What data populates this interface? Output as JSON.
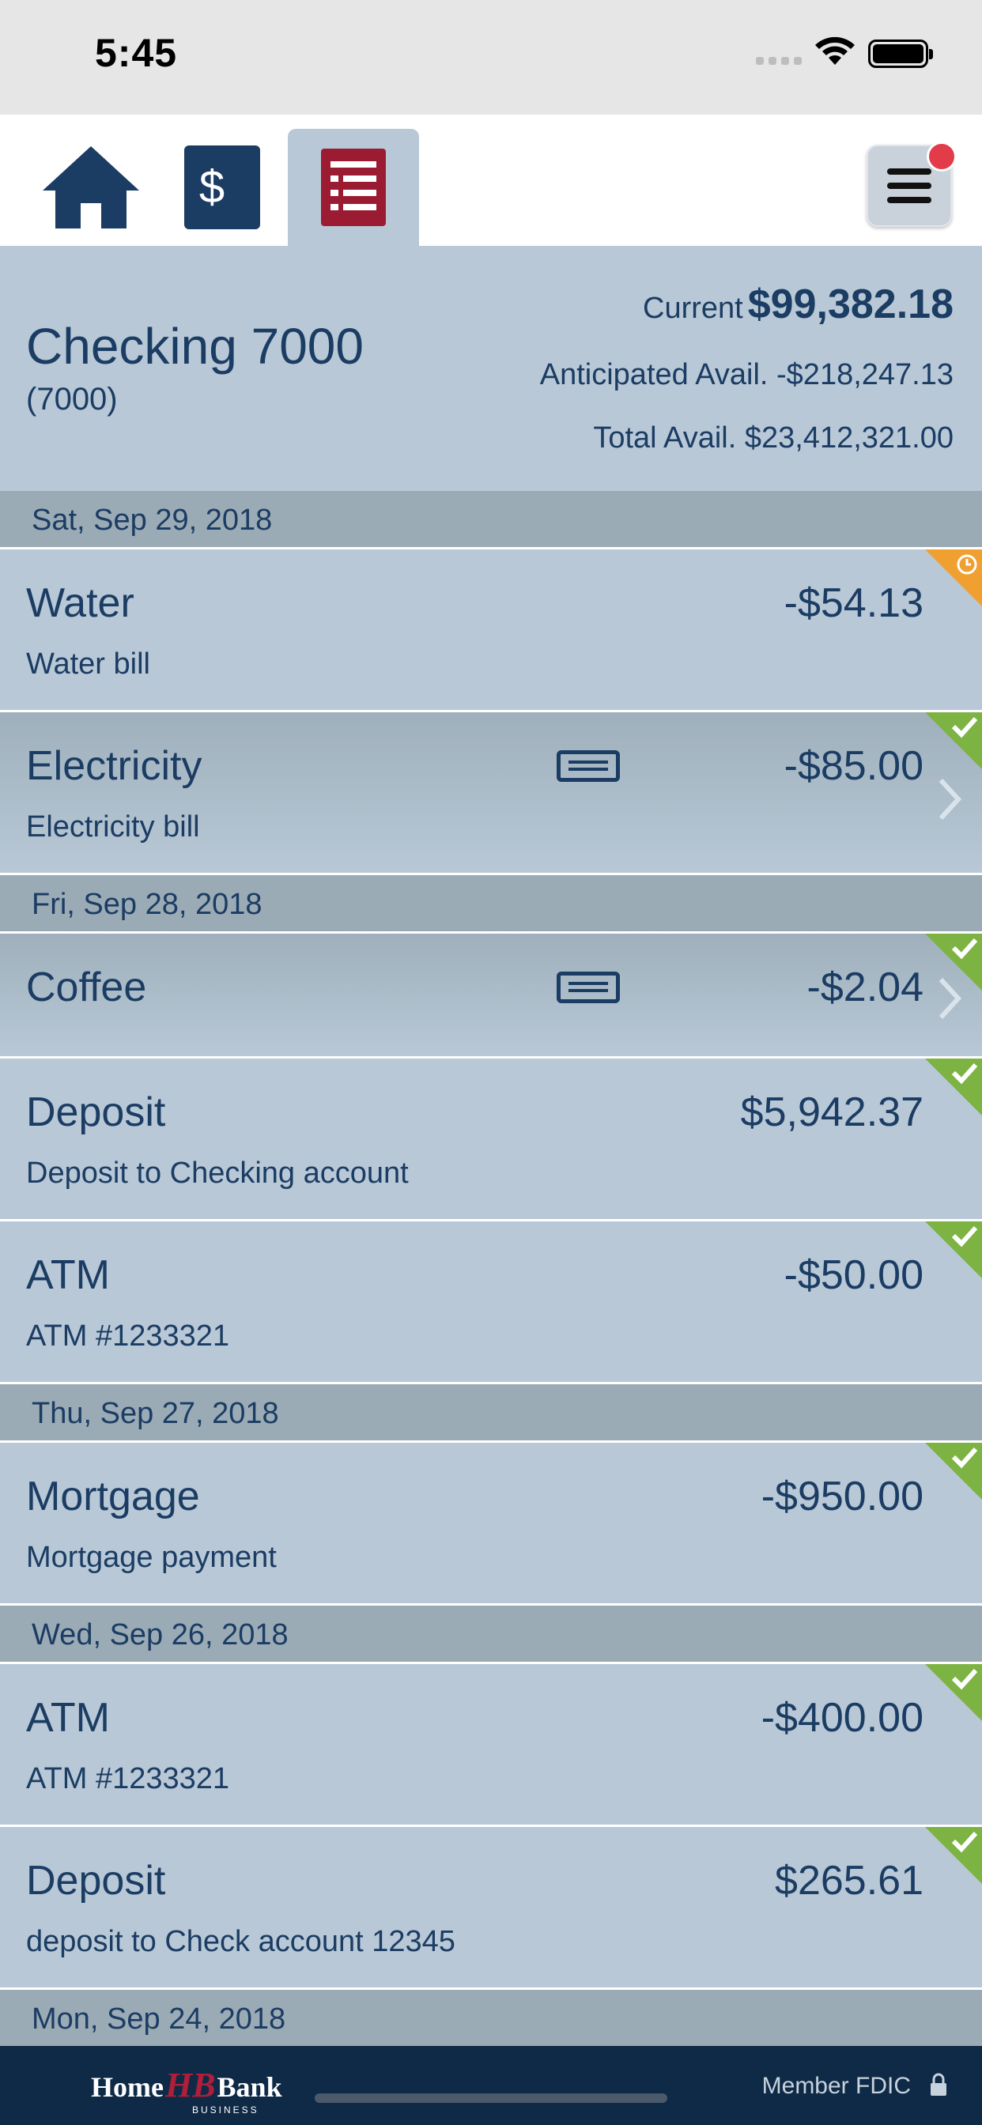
{
  "status_bar": {
    "time": "5:45"
  },
  "nav": {
    "items": [
      {
        "name": "home",
        "icon": "house-icon"
      },
      {
        "name": "accounts",
        "icon": "dollar-bills-icon"
      },
      {
        "name": "register",
        "icon": "register-ledger-icon",
        "active": true
      }
    ],
    "menu_icon": "hamburger-menu-icon",
    "notification": true
  },
  "account": {
    "name": "Checking 7000",
    "number": "(7000)",
    "current_label": "Current",
    "current_value": "$99,382.18",
    "anticipated": "Anticipated Avail. -$218,247.13",
    "total": "Total Avail. $23,412,321.00"
  },
  "groups": [
    {
      "date": "Sat, Sep 29, 2018",
      "transactions": [
        {
          "name": "Water",
          "memo": "Water bill",
          "amount": "-$54.13",
          "status": "pending"
        },
        {
          "name": "Electricity",
          "memo": "Electricity bill",
          "amount": "-$85.00",
          "status": "cleared",
          "has_check": true
        }
      ]
    },
    {
      "date": "Fri, Sep 28, 2018",
      "transactions": [
        {
          "name": "Coffee",
          "memo": "",
          "amount": "-$2.04",
          "status": "cleared",
          "has_check": true
        },
        {
          "name": "Deposit",
          "memo": "Deposit to Checking account",
          "amount": "$5,942.37",
          "status": "cleared"
        },
        {
          "name": "ATM",
          "memo": "ATM #1233321",
          "amount": "-$50.00",
          "status": "cleared"
        }
      ]
    },
    {
      "date": "Thu, Sep 27, 2018",
      "transactions": [
        {
          "name": "Mortgage",
          "memo": "Mortgage payment",
          "amount": "-$950.00",
          "status": "cleared"
        }
      ]
    },
    {
      "date": "Wed, Sep 26, 2018",
      "transactions": [
        {
          "name": "ATM",
          "memo": "ATM #1233321",
          "amount": "-$400.00",
          "status": "cleared"
        },
        {
          "name": "Deposit",
          "memo": "deposit to Check account 12345",
          "amount": "$265.61",
          "status": "cleared"
        }
      ]
    },
    {
      "date": "Mon, Sep 24, 2018",
      "transactions": []
    }
  ],
  "footer": {
    "logo_home": "Home",
    "logo_mark": "HB",
    "logo_bank": "Bank",
    "logo_sub": "BUSINESS",
    "fdic": "Member FDIC"
  },
  "colors": {
    "navy": "#1b3c63",
    "panel": "#b8c8d6",
    "date_header": "#9babb5",
    "pending": "#f0a030",
    "cleared": "#7cb342",
    "accent_red": "#9b1c32",
    "footer": "#0f2a47"
  }
}
